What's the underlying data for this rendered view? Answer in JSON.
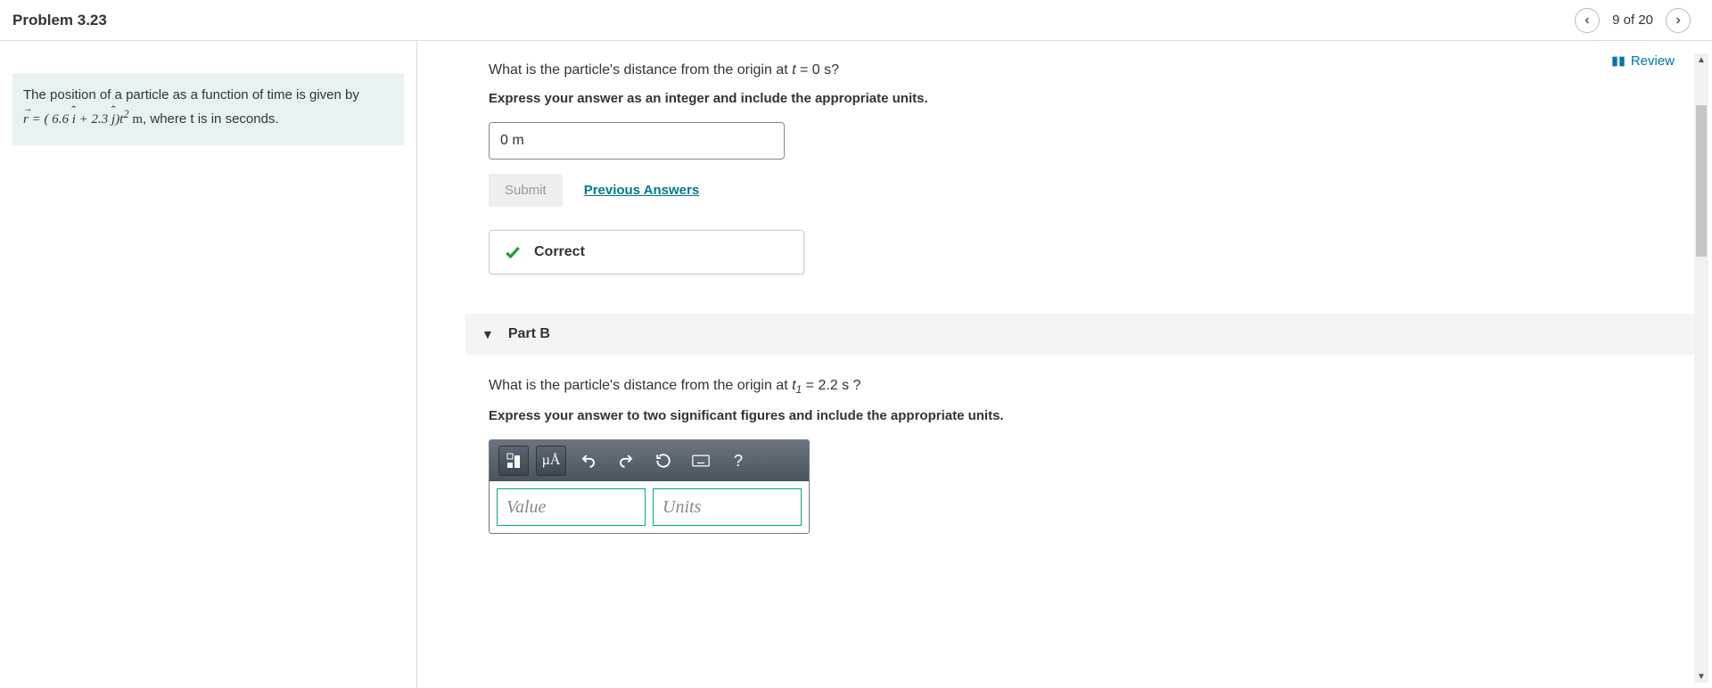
{
  "header": {
    "title": "Problem 3.23",
    "pager": "9 of 20"
  },
  "review_label": "Review",
  "prompt": {
    "line1": "The position of a particle as a function of time is given by",
    "eq_prefix": "r",
    "eq_mid": " = ( 6.6 ",
    "eq_i": "i",
    "eq_plus": " + 2.3 ",
    "eq_j": "j",
    "eq_tail": ")t",
    "eq_exp": "2",
    "eq_units": " m",
    "line2_tail": ", where t is in seconds."
  },
  "partA": {
    "question_pre": "What is the particle's distance from the origin at ",
    "question_var": "t",
    "question_post": " = 0 s?",
    "instruction": "Express your answer as an integer and include the appropriate units.",
    "answer_value": "0 m",
    "submit_label": "Submit",
    "prev_answers_label": "Previous Answers",
    "correct_label": "Correct"
  },
  "partB": {
    "header_label": "Part B",
    "question_pre": "What is the particle's distance from the origin at ",
    "question_var": "t",
    "question_sub": "1",
    "question_post": " = 2.2 s ?",
    "instruction": "Express your answer to two significant figures and include the appropriate units.",
    "value_placeholder": "Value",
    "units_placeholder": "Units",
    "mu_label": "µÅ",
    "help_label": "?"
  }
}
